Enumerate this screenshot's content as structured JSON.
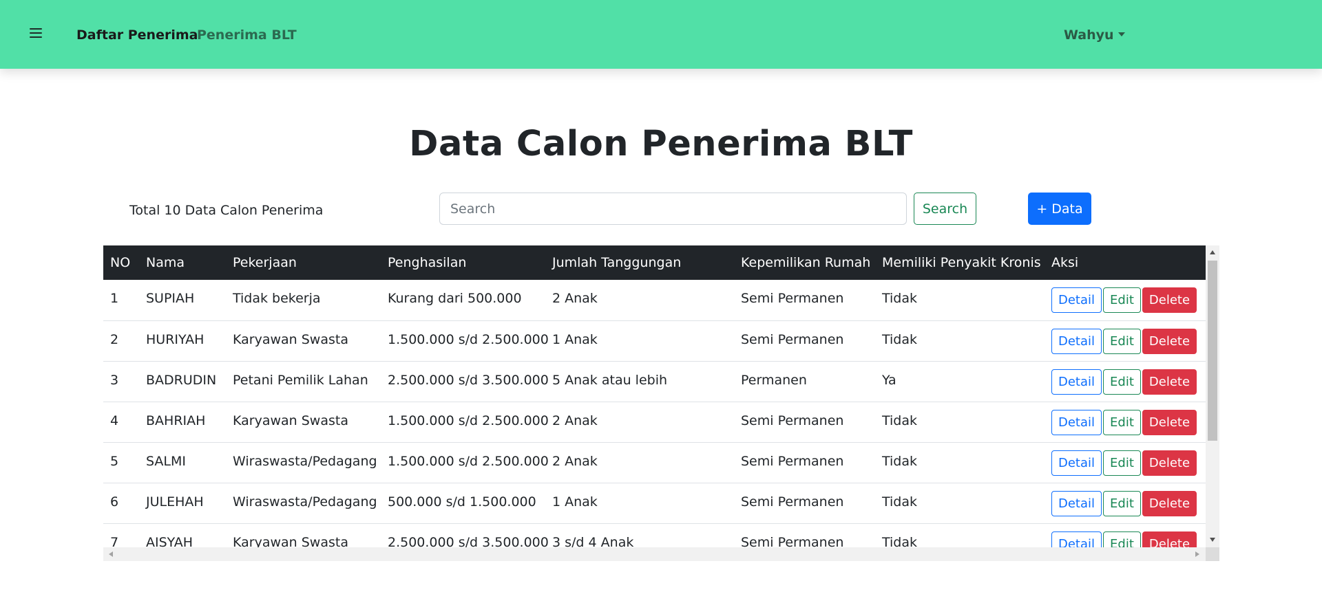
{
  "navbar": {
    "menu_icon": "hamburger-icon",
    "brand": "Daftar Penerima",
    "link": "Penerima BLT",
    "user": "Wahyu",
    "user_caret_icon": "caret-down-icon",
    "background": "#51e0a7"
  },
  "page": {
    "title": "Data Calon Penerima BLT"
  },
  "toolbar": {
    "total_text": "Total 10 Data Calon Penerima",
    "search_placeholder": "Search",
    "search_value": "",
    "search_button": "Search",
    "add_button": "+ Data"
  },
  "table": {
    "columns": [
      "NO",
      "Nama",
      "Pekerjaan",
      "Penghasilan",
      "Jumlah Tanggungan",
      "Kepemilikan Rumah",
      "Memiliki Penyakit Kronis",
      "Aksi"
    ],
    "action_labels": {
      "detail": "Detail",
      "edit": "Edit",
      "delete": "Delete"
    },
    "rows": [
      [
        "1",
        "SUPIAH",
        "Tidak bekerja",
        "Kurang dari 500.000",
        "2 Anak",
        "Semi Permanen",
        "Tidak"
      ],
      [
        "2",
        "HURIYAH",
        "Karyawan Swasta",
        "1.500.000 s/d 2.500.000",
        "1 Anak",
        "Semi Permanen",
        "Tidak"
      ],
      [
        "3",
        "BADRUDIN",
        "Petani Pemilik Lahan",
        "2.500.000 s/d 3.500.000",
        "5 Anak atau lebih",
        "Permanen",
        "Ya"
      ],
      [
        "4",
        "BAHRIAH",
        "Karyawan Swasta",
        "1.500.000 s/d 2.500.000",
        "2 Anak",
        "Semi Permanen",
        "Tidak"
      ],
      [
        "5",
        "SALMI",
        "Wiraswasta/Pedagang",
        "1.500.000 s/d 2.500.000",
        "2 Anak",
        "Semi Permanen",
        "Tidak"
      ],
      [
        "6",
        "JULEHAH",
        "Wiraswasta/Pedagang",
        "500.000 s/d 1.500.000",
        "1 Anak",
        "Semi Permanen",
        "Tidak"
      ],
      [
        "7",
        "AISYAH",
        "Karyawan Swasta",
        "2.500.000 s/d 3.500.000",
        "3 s/d 4 Anak",
        "Semi Permanen",
        "Tidak"
      ]
    ]
  },
  "colors": {
    "accent_success": "#198754",
    "accent_primary": "#0d6efd",
    "accent_danger": "#dc3545",
    "table_header": "#212529"
  }
}
